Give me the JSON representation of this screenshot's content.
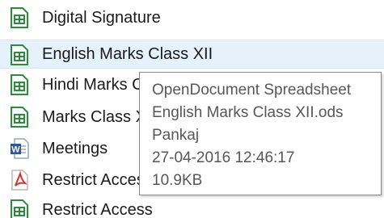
{
  "files": [
    {
      "name": "Digital Signature",
      "icon": "spreadsheet-icon",
      "selected": false
    },
    {
      "name": "English Marks Class XII",
      "icon": "spreadsheet-icon",
      "selected": true
    },
    {
      "name": "Hindi Marks C",
      "icon": "spreadsheet-icon",
      "selected": false
    },
    {
      "name": "Marks Class X",
      "icon": "spreadsheet-icon",
      "selected": false
    },
    {
      "name": "Meetings",
      "icon": "word-document-icon",
      "selected": false
    },
    {
      "name": "Restrict Acces",
      "icon": "pdf-icon",
      "selected": false
    },
    {
      "name": "Restrict Access",
      "icon": "spreadsheet-icon",
      "selected": false
    }
  ],
  "tooltip": {
    "type": "OpenDocument Spreadsheet",
    "filename": "English Marks Class XII.ods",
    "author": "Pankaj",
    "modified": "27-04-2016 12:46:17",
    "size": "10.9KB"
  },
  "colors": {
    "spreadsheet_green": "#2e8b3e",
    "word_blue": "#2b579a",
    "pdf_red": "#d9342b",
    "selection": "#e5f1fb"
  }
}
